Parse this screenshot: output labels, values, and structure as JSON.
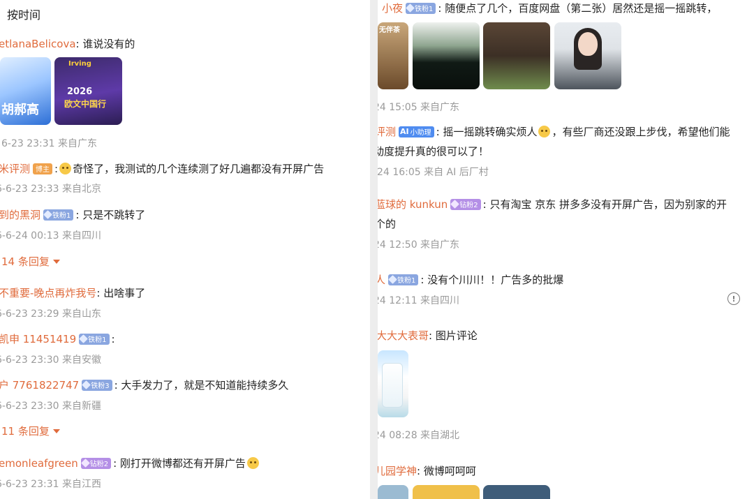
{
  "left": {
    "sort_label": "按时间",
    "comments": [
      {
        "user": "etlanaBelicova",
        "text": ": 谁说没有的",
        "meta": null
      },
      {
        "thumb1_caption": "胡郝高",
        "thumb2": {
          "name": "Irving",
          "year": "2026",
          "title": "欧文中国行"
        }
      },
      {
        "meta": "6-23 23:31 来自广东"
      },
      {
        "user": "米评测",
        "badge": "博主",
        "text": "奇怪了，我测试的几个连续测了好几遍都没有开屏广告",
        "meta": "6-6-23 23:33 来自北京"
      },
      {
        "user": "到的黑洞",
        "badge": "铁粉1",
        "text": ": 只是不跳转了",
        "meta": "6-6-24 00:13 来自四川"
      }
    ],
    "replies_1": "14 条回复",
    "c6": {
      "user": "不重要-晚点再炸我号",
      "text": ": 出啥事了",
      "meta": "6-6-23 23:29 来自山东"
    },
    "c7": {
      "user": "凯申 11451419",
      "badge": "铁粉1",
      "text": ":",
      "meta": "6-6-23 23:30 来自安徽"
    },
    "c8": {
      "user": "户 7761822747",
      "badge": "铁粉3",
      "text": ": 大手发力了，就是不知道能持续多久",
      "meta": "6-6-23 23:30 来自新疆"
    },
    "replies_2": "11 条回复",
    "c9": {
      "user": "emonleafgreen",
      "badge": "钻粉2",
      "text": ": 刚打开微博都还有开屏广告",
      "meta": "6-6-23 23:31 来自江西"
    }
  },
  "right": {
    "c1": {
      "user": "小夜",
      "badge": "铁粉1",
      "text": ": 随便点了几个，百度网盘（第二张）居然还是摇一摇跳转，",
      "meta": "24 15:05 来自广东",
      "img1_text": "无伴茶"
    },
    "c2": {
      "user": "评测",
      "badge": "小助理",
      "badge_ai": "AI",
      "text_a": ": 摇一摇跳转确实烦人",
      "text_b": "，有些厂商还没跟上步伐，希望他们能",
      "text_c": "动度提升真的很可以了！",
      "meta": "-24 16:05 来自 AI 后厂村"
    },
    "c3": {
      "user": "蓝球的 kunkun",
      "badge": "钻粉2",
      "text": ": 只有淘宝 京东 拼多多没有开屏广告，因为别家的开",
      "text2": "个的",
      "meta": "24 12:50 来自广东"
    },
    "c4": {
      "user": "人",
      "badge": "铁粉1",
      "text": ": 没有个川川！！广告多的批爆",
      "meta": "24 12:11 来自四川"
    },
    "c5": {
      "user": "大大大表哥",
      "text": ": 图片评论",
      "meta": "24 08:28 来自湖北"
    },
    "c6": {
      "user": "儿园学神",
      "text": ": 微博呵呵呵"
    },
    "report_icon": "!"
  }
}
